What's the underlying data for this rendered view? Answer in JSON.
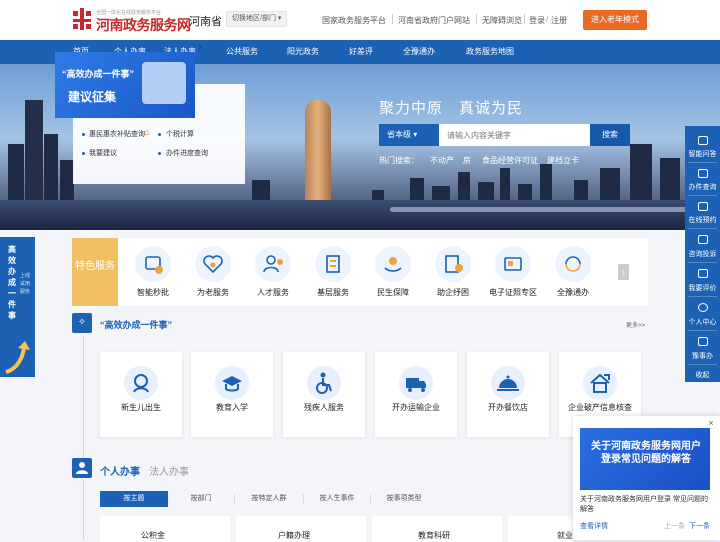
{
  "header": {
    "logo_small": "全国一体化在线政务服务平台",
    "logo_big": "河南政务服务网",
    "province": "河南省",
    "switch_label": "切换地区/部门 ▾",
    "links": [
      "国家政务服务平台",
      "河南省政府门户网站",
      "无障碍浏览",
      "登录",
      "注册"
    ],
    "elder_button": "进入老年模式"
  },
  "nav": {
    "items": [
      "首页",
      "个人办事",
      "法人办事",
      "公共服务",
      "阳光政务",
      "好差评",
      "全豫通办",
      "政务服务地图"
    ]
  },
  "hero": {
    "slogan": "聚力中原　真诚为民",
    "search_scope": "省本级 ▾",
    "search_placeholder": "请输入内容关键字",
    "search_button": "搜索",
    "hot_label": "热门搜索：",
    "hot_items": [
      "不动产",
      "房",
      "食品经营许可证",
      "建档立卡"
    ]
  },
  "popup": {
    "title1": "“高效办成一件事”",
    "title2": "建议征集",
    "close": "×",
    "links": [
      "惠民惠农补贴查询",
      "个税计算",
      "我要建议",
      "办件进度查询"
    ]
  },
  "left_float": {
    "big": "高效办成一件事",
    "small": "上线试用服务"
  },
  "featured": {
    "label": "特色服务",
    "items": [
      "智能秒批",
      "为老服务",
      "人才服务",
      "基层服务",
      "民生保障",
      "助企纾困",
      "电子证照专区",
      "全豫通办"
    ],
    "arrow": "›"
  },
  "section1": {
    "title": "“高效办成一件事”",
    "more": "更多>>",
    "cards": [
      "新生儿出生",
      "教育入学",
      "残疾人服务",
      "开办运输企业",
      "开办餐饮店",
      "企业破产信息核查"
    ]
  },
  "section2": {
    "title": "个人办事",
    "title2": "法人办事",
    "tabs": [
      "按主题",
      "按部门",
      "按特定人群",
      "按人生事件",
      "按事项类型"
    ],
    "cards": [
      "公积金",
      "户籍办理",
      "教育科研",
      "就业"
    ]
  },
  "right_float": {
    "items": [
      "智能问答",
      "办件查询",
      "在线预约",
      "咨询投诉",
      "我要评价",
      "个人中心",
      "豫事办",
      "收起"
    ]
  },
  "notice": {
    "image_text": "关于河南政务服务网用户登录常见问题的解答",
    "text": "关于河南政务服务网用户登录 常见问题的解答",
    "detail": "查看详情",
    "prev": "上一条",
    "next": "下一条",
    "close": "×"
  },
  "colors": {
    "brand_blue": "#1c61b4",
    "logo_red": "#c6282b",
    "elder_orange": "#e96a25",
    "feature_gold": "#f0bf62"
  }
}
